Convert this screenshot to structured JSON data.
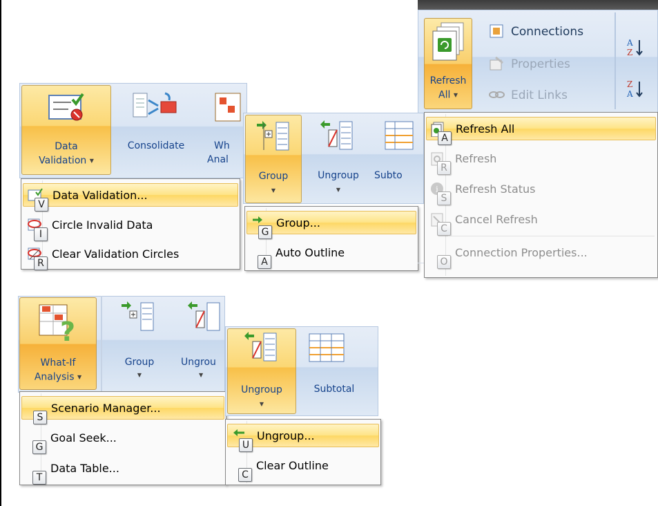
{
  "data_panel": {
    "buttons": {
      "data_validation": "Data",
      "data_validation_2": "Validation",
      "consolidate": "Consolidate",
      "whatif_partial_1": "Wh",
      "whatif_partial_2": "Anal"
    },
    "menu": [
      {
        "label": "Data Validation...",
        "key": "V"
      },
      {
        "label": "Circle Invalid Data",
        "key": "I"
      },
      {
        "label": "Clear Validation Circles",
        "key": "R"
      }
    ]
  },
  "group_panel": {
    "buttons": {
      "group": "Group",
      "ungroup": "Ungroup",
      "subtotal_partial": "Subto"
    },
    "menu": [
      {
        "label": "Group...",
        "key": "G"
      },
      {
        "label": "Auto Outline",
        "key": "A"
      }
    ]
  },
  "refresh_panel": {
    "buttons": {
      "refresh_all_1": "Refresh",
      "refresh_all_2": "All",
      "connections": "Connections",
      "properties": "Properties",
      "edit_links": "Edit Links"
    },
    "menu": [
      {
        "label": "Refresh All",
        "key": "A"
      },
      {
        "label": "Refresh",
        "key": "R"
      },
      {
        "label": "Refresh Status",
        "key": "S"
      },
      {
        "label": "Cancel Refresh",
        "key": "C"
      },
      {
        "label": "Connection Properties...",
        "key": "O"
      }
    ]
  },
  "whatif_panel": {
    "buttons": {
      "whatif_1": "What-If",
      "whatif_2": "Analysis",
      "group": "Group",
      "ungroup_partial": "Ungrou"
    },
    "menu": [
      {
        "label": "Scenario Manager...",
        "key": "S"
      },
      {
        "label": "Goal Seek...",
        "key": "G"
      },
      {
        "label": "Data Table...",
        "key": "T"
      }
    ]
  },
  "ungroup_panel": {
    "buttons": {
      "ungroup": "Ungroup",
      "subtotal": "Subtotal"
    },
    "menu": [
      {
        "label": "Ungroup...",
        "key": "U"
      },
      {
        "label": "Clear Outline",
        "key": "C"
      }
    ]
  }
}
